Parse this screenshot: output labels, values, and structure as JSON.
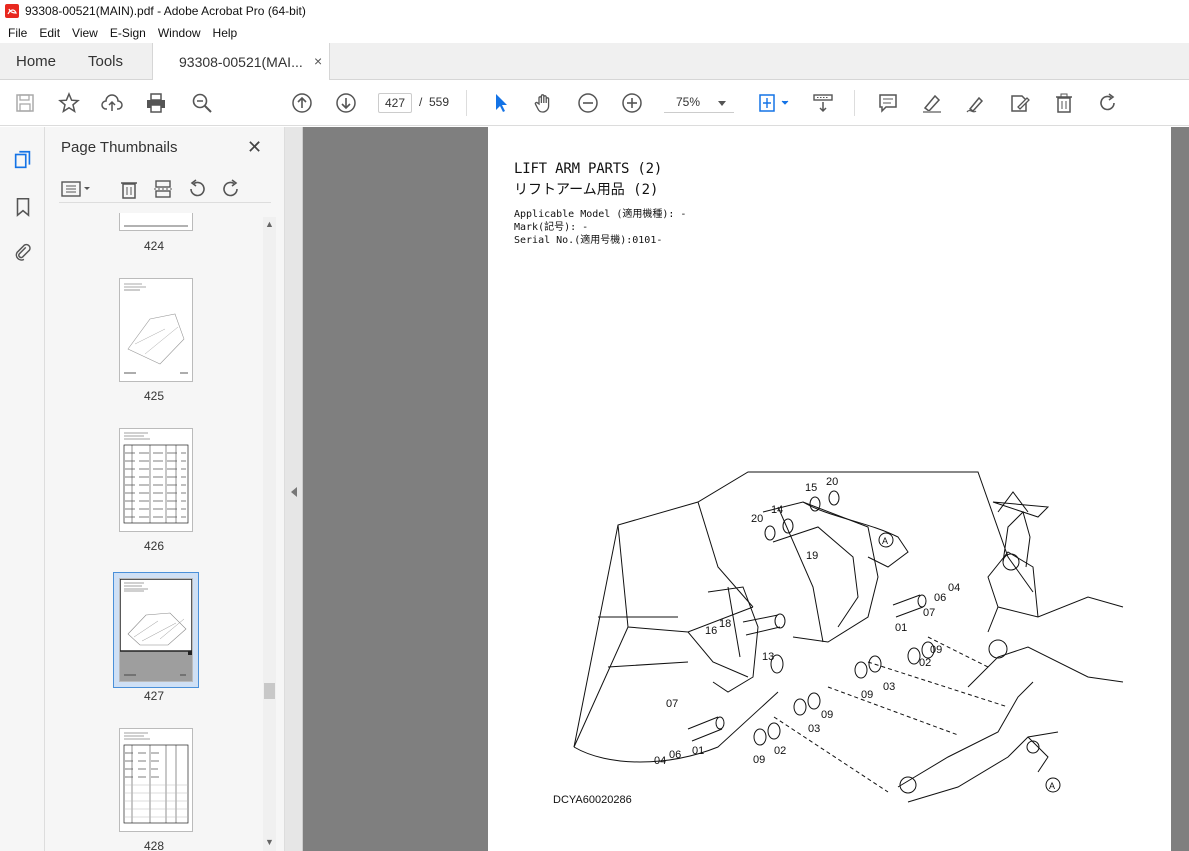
{
  "window": {
    "title": "93308-00521(MAIN).pdf - Adobe Acrobat Pro (64-bit)"
  },
  "menu": [
    "File",
    "Edit",
    "View",
    "E-Sign",
    "Window",
    "Help"
  ],
  "tabs": {
    "home": "Home",
    "tools": "Tools",
    "document": "93308-00521(MAI...",
    "close": "×"
  },
  "toolbar": {
    "current_page": "427",
    "page_separator": "/",
    "total_pages": "559",
    "zoom": "75%"
  },
  "panel": {
    "title": "Page Thumbnails",
    "close": "✕",
    "thumbnails": [
      {
        "label": "424"
      },
      {
        "label": "425"
      },
      {
        "label": "426"
      },
      {
        "label": "427",
        "selected": true
      },
      {
        "label": "428"
      }
    ]
  },
  "document_page": {
    "title_en": "LIFT ARM PARTS (2)",
    "title_jp": "リフトアーム用品 (2)",
    "applicable_model": "Applicable Model (適用機種): -",
    "mark": "Mark(記号): -",
    "serial": "Serial No.(適用号機):0101-",
    "drawing_code": "DCYA60020286",
    "callouts": [
      "20",
      "15",
      "14",
      "20",
      "19",
      "A",
      "04",
      "06",
      "07",
      "01",
      "16",
      "18",
      "13",
      "09",
      "02",
      "09",
      "03",
      "07",
      "06",
      "04",
      "01",
      "09",
      "03",
      "09",
      "02",
      "A"
    ]
  },
  "colors": {
    "accent": "#1473e6",
    "canvas_bg": "#7f7f7f",
    "selection": "#cfe0f5"
  }
}
